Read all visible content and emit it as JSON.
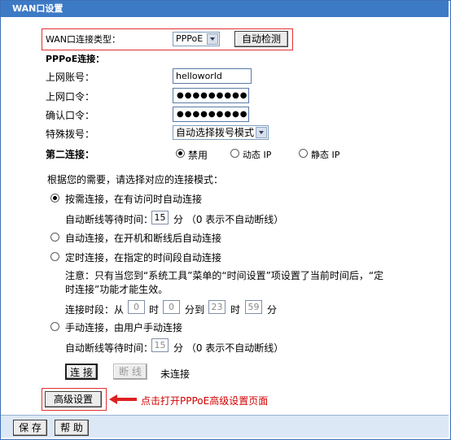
{
  "title": "WAN口设置",
  "wan_type": {
    "label": "WAN口连接类型：",
    "value": "PPPoE",
    "detect_button": "自动检测"
  },
  "pppoe_heading": "PPPoE连接：",
  "account": {
    "label": "上网账号：",
    "value": "helloworld"
  },
  "password": {
    "label": "上网口令：",
    "value": "●●●●●●●●●"
  },
  "confirm": {
    "label": "确认口令：",
    "value": "●●●●●●●●●"
  },
  "dial": {
    "label": "特殊拨号：",
    "value": "自动选择拨号模式"
  },
  "second": {
    "label": "第二连接：",
    "options": [
      "禁用",
      "动态 IP",
      "静态 IP"
    ],
    "selected": 0
  },
  "mode_prompt": "根据您的需要，请选择对应的连接模式：",
  "mode_on_demand": {
    "label": "按需连接，在有访问时自动连接",
    "idle_prefix": "自动断线等待时间：",
    "idle_value": "15",
    "idle_suffix": "分 （0 表示不自动断线）"
  },
  "mode_auto": {
    "label": "自动连接，在开机和断线后自动连接"
  },
  "mode_timed": {
    "label": "定时连接，在指定的时间段自动连接",
    "note_line1": "注意：只有当您到“系统工具”菜单的“时间设置”项设置了当前时间后，“定",
    "note_line2": "时连接”功能才能生效。",
    "period_prefix": "连接时段：从",
    "from_hour": "0",
    "hour_label": "时",
    "from_min": "0",
    "to_label": "分到",
    "to_hour": "23",
    "hour_label2": "时",
    "to_min": "59",
    "min_label": "分"
  },
  "mode_manual": {
    "label": "手动连接，由用户手动连接",
    "idle_prefix": "自动断线等待时间：",
    "idle_value": "15",
    "idle_suffix": "分 （0 表示不自动断线）"
  },
  "connect_button": "连 接",
  "disconnect_button": "断 线",
  "status": "未连接",
  "advanced_button": "高级设置",
  "advanced_annotation": "点击打开PPPoE高级设置页面",
  "save_button": "保 存",
  "help_button": "帮 助"
}
